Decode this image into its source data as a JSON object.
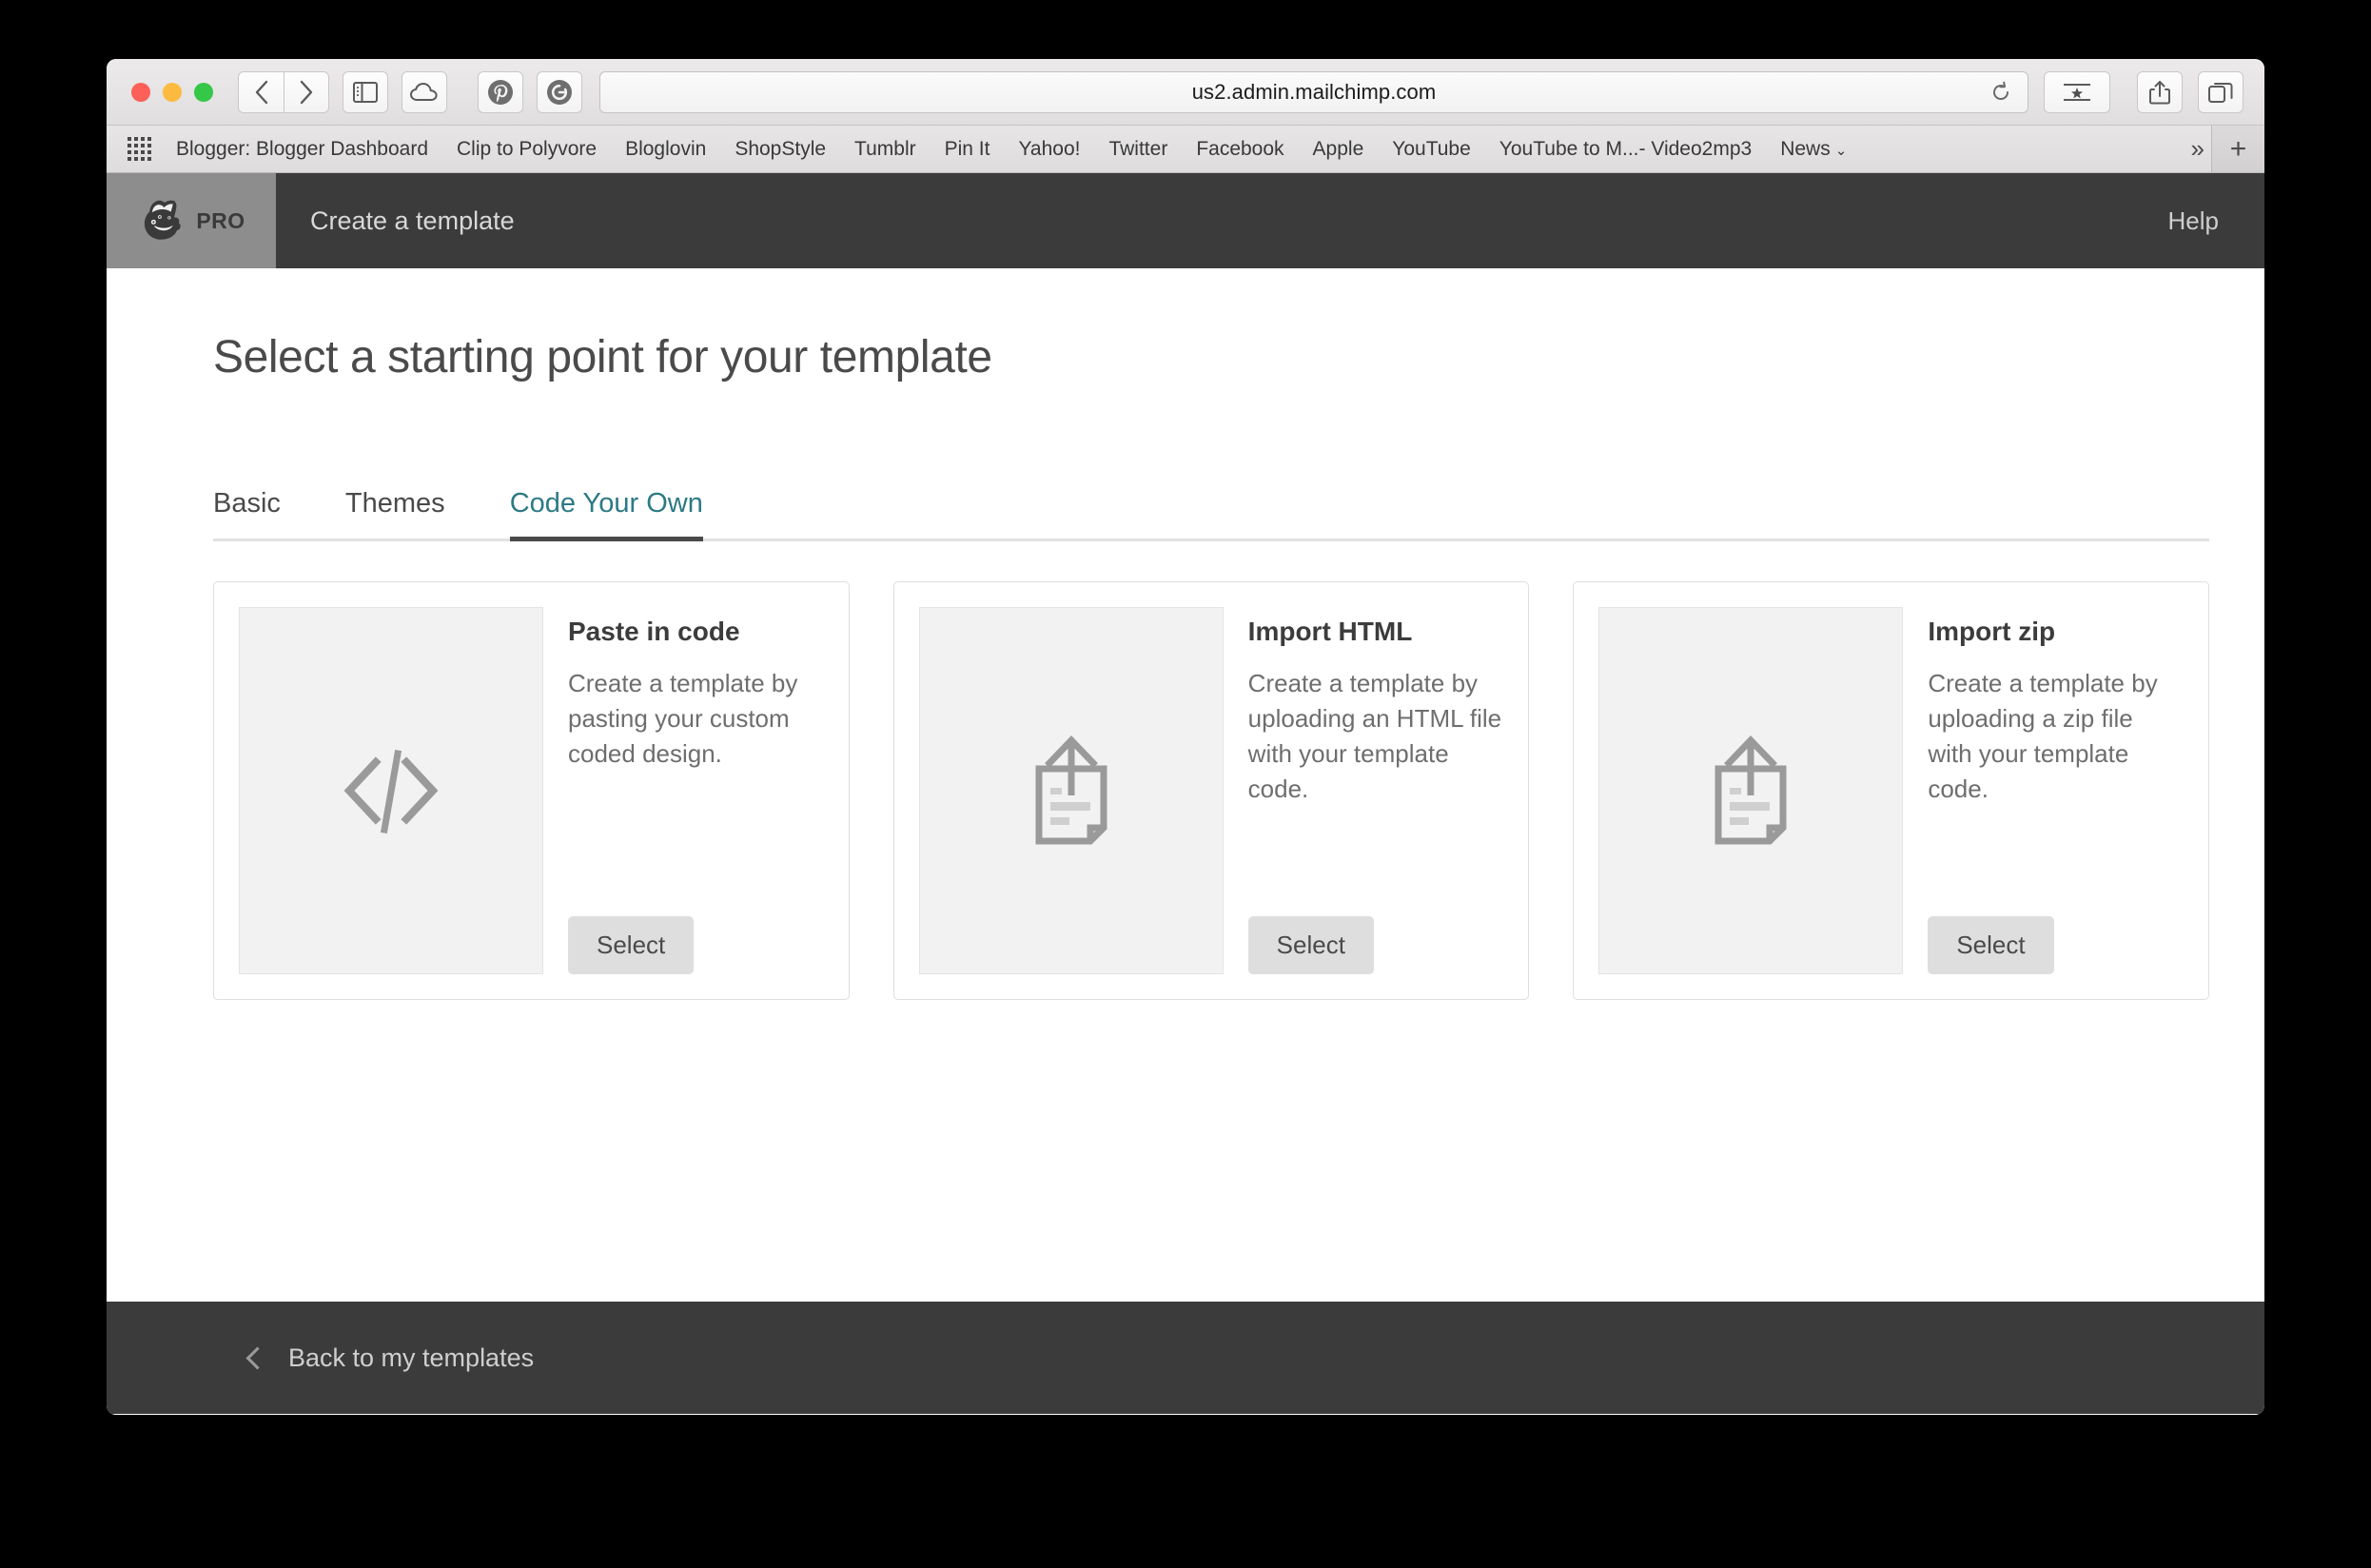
{
  "browser": {
    "traffic_lights": [
      "close",
      "minimize",
      "maximize"
    ],
    "back_icon": "chevron-left-icon",
    "forward_icon": "chevron-right-icon",
    "sidebar_icon": "sidebar-icon",
    "cloud_icon": "cloud-icon",
    "extensions": [
      "pinterest-icon",
      "grammarly-icon"
    ],
    "url": "us2.admin.mailchimp.com",
    "reload_icon": "reload-icon",
    "bookmark_star_icon": "bookmark-star-icon",
    "share_icon": "share-icon",
    "tabs_icon": "show-all-tabs-icon",
    "bookmarks": [
      {
        "label": "Blogger: Blogger Dashboard"
      },
      {
        "label": "Clip to Polyvore"
      },
      {
        "label": "Bloglovin"
      },
      {
        "label": "ShopStyle"
      },
      {
        "label": "Tumblr"
      },
      {
        "label": "Pin It"
      },
      {
        "label": "Yahoo!"
      },
      {
        "label": "Twitter"
      },
      {
        "label": "Facebook"
      },
      {
        "label": "Apple"
      },
      {
        "label": "YouTube"
      },
      {
        "label": "YouTube to M...- Video2mp3"
      },
      {
        "label": "News",
        "caret": "⌄"
      }
    ],
    "bookmarks_overflow": "»",
    "bookmarks_add": "+"
  },
  "app": {
    "brand_icon": "mailchimp-freddie-logo",
    "pro_badge": "PRO",
    "title": "Create a template",
    "help_label": "Help"
  },
  "main": {
    "page_title": "Select a starting point for your template",
    "tabs": [
      {
        "label": "Basic",
        "active": false
      },
      {
        "label": "Themes",
        "active": false
      },
      {
        "label": "Code Your Own",
        "active": true
      }
    ],
    "cards": [
      {
        "icon": "code-brackets-icon",
        "title": "Paste in code",
        "description": "Create a template by pasting your custom coded design.",
        "button": "Select"
      },
      {
        "icon": "file-upload-icon",
        "title": "Import HTML",
        "description": "Create a template by uploading an HTML file with your template code.",
        "button": "Select"
      },
      {
        "icon": "file-upload-icon",
        "title": "Import zip",
        "description": "Create a template by uploading a zip file with your template code.",
        "button": "Select"
      }
    ]
  },
  "footer": {
    "back_icon": "chevron-left-icon",
    "back_label": "Back to my templates"
  },
  "colors": {
    "accent_teal": "#2c7a84",
    "header_dark": "#3b3b3b",
    "logo_bg": "#8d8d8d",
    "button_gray": "#dedede"
  }
}
